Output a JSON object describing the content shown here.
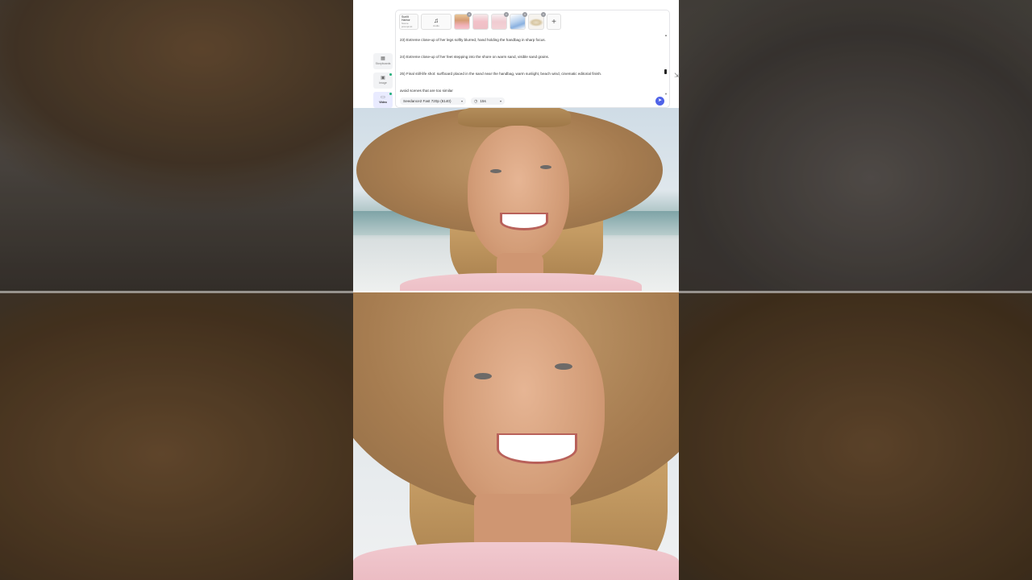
{
  "sidebar": {
    "items": [
      {
        "icon": "storyboard-icon",
        "label": "Storyboards",
        "active": false,
        "dot": false
      },
      {
        "icon": "image-icon",
        "label": "Image",
        "active": false,
        "dot": true
      },
      {
        "icon": "video-icon",
        "label": "Video",
        "active": true,
        "dot": true
      }
    ]
  },
  "references": {
    "text_card": {
      "line1": "Sunlit Harbor",
      "line2": "Scene prompt.txt"
    },
    "audio_card": {
      "icon": "music-icon",
      "label": "Audio"
    },
    "images": [
      {
        "name": "woman-reference",
        "badge": "×"
      },
      {
        "name": "dress-front-reference",
        "badge": "×"
      },
      {
        "name": "dress-back-reference",
        "badge": "×"
      },
      {
        "name": "handbag-reference",
        "badge": "×"
      },
      {
        "name": "hat-reference",
        "badge": "×"
      }
    ],
    "add_label": "+"
  },
  "prompt": {
    "lines": [
      "23) Extreme close-up of her legs softly blurred, hand holding the handbag in sharp focus.",
      "24) Extreme close-up of her feet stepping into the shore on warm sand, visible sand grains.",
      "25) Final still-life shot: surfboard placed in the sand near the handbag, warm sunlight, beach wind, cinematic editorial finish.",
      "avoid scenes that are too similar"
    ]
  },
  "controls": {
    "model": "Seedance2 Fast 720p (6140)",
    "duration": "15s",
    "send_icon": "send-icon"
  },
  "colors": {
    "accent": "#4f63e8",
    "active_dot": "#21b07a"
  }
}
